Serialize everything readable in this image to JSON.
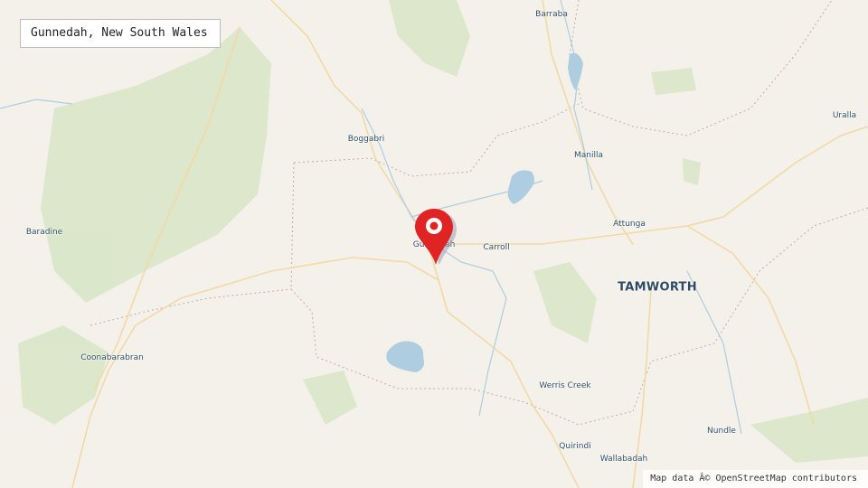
{
  "title": "Gunnedah, New South Wales",
  "attribution": "Map data Â© OpenStreetMap contributors",
  "places": {
    "barraba": "Barraba",
    "boggabri": "Boggabri",
    "manilla": "Manilla",
    "uralla": "Uralla",
    "baradine": "Baradine",
    "gunnedah": "Gunnedah",
    "carroll": "Carroll",
    "attunga": "Attunga",
    "tamworth": "TAMWORTH",
    "coonabarabran": "Coonabarabran",
    "werris_creek": "Werris Creek",
    "quirindi": "Quirindi",
    "wallabadah": "Wallabadah",
    "nundle": "Nundle"
  },
  "colors": {
    "land": "#f4f1ea",
    "forest": "#d9e6c8",
    "water": "#aecde0",
    "road": "#f2d9a6",
    "marker": "#e02424"
  }
}
